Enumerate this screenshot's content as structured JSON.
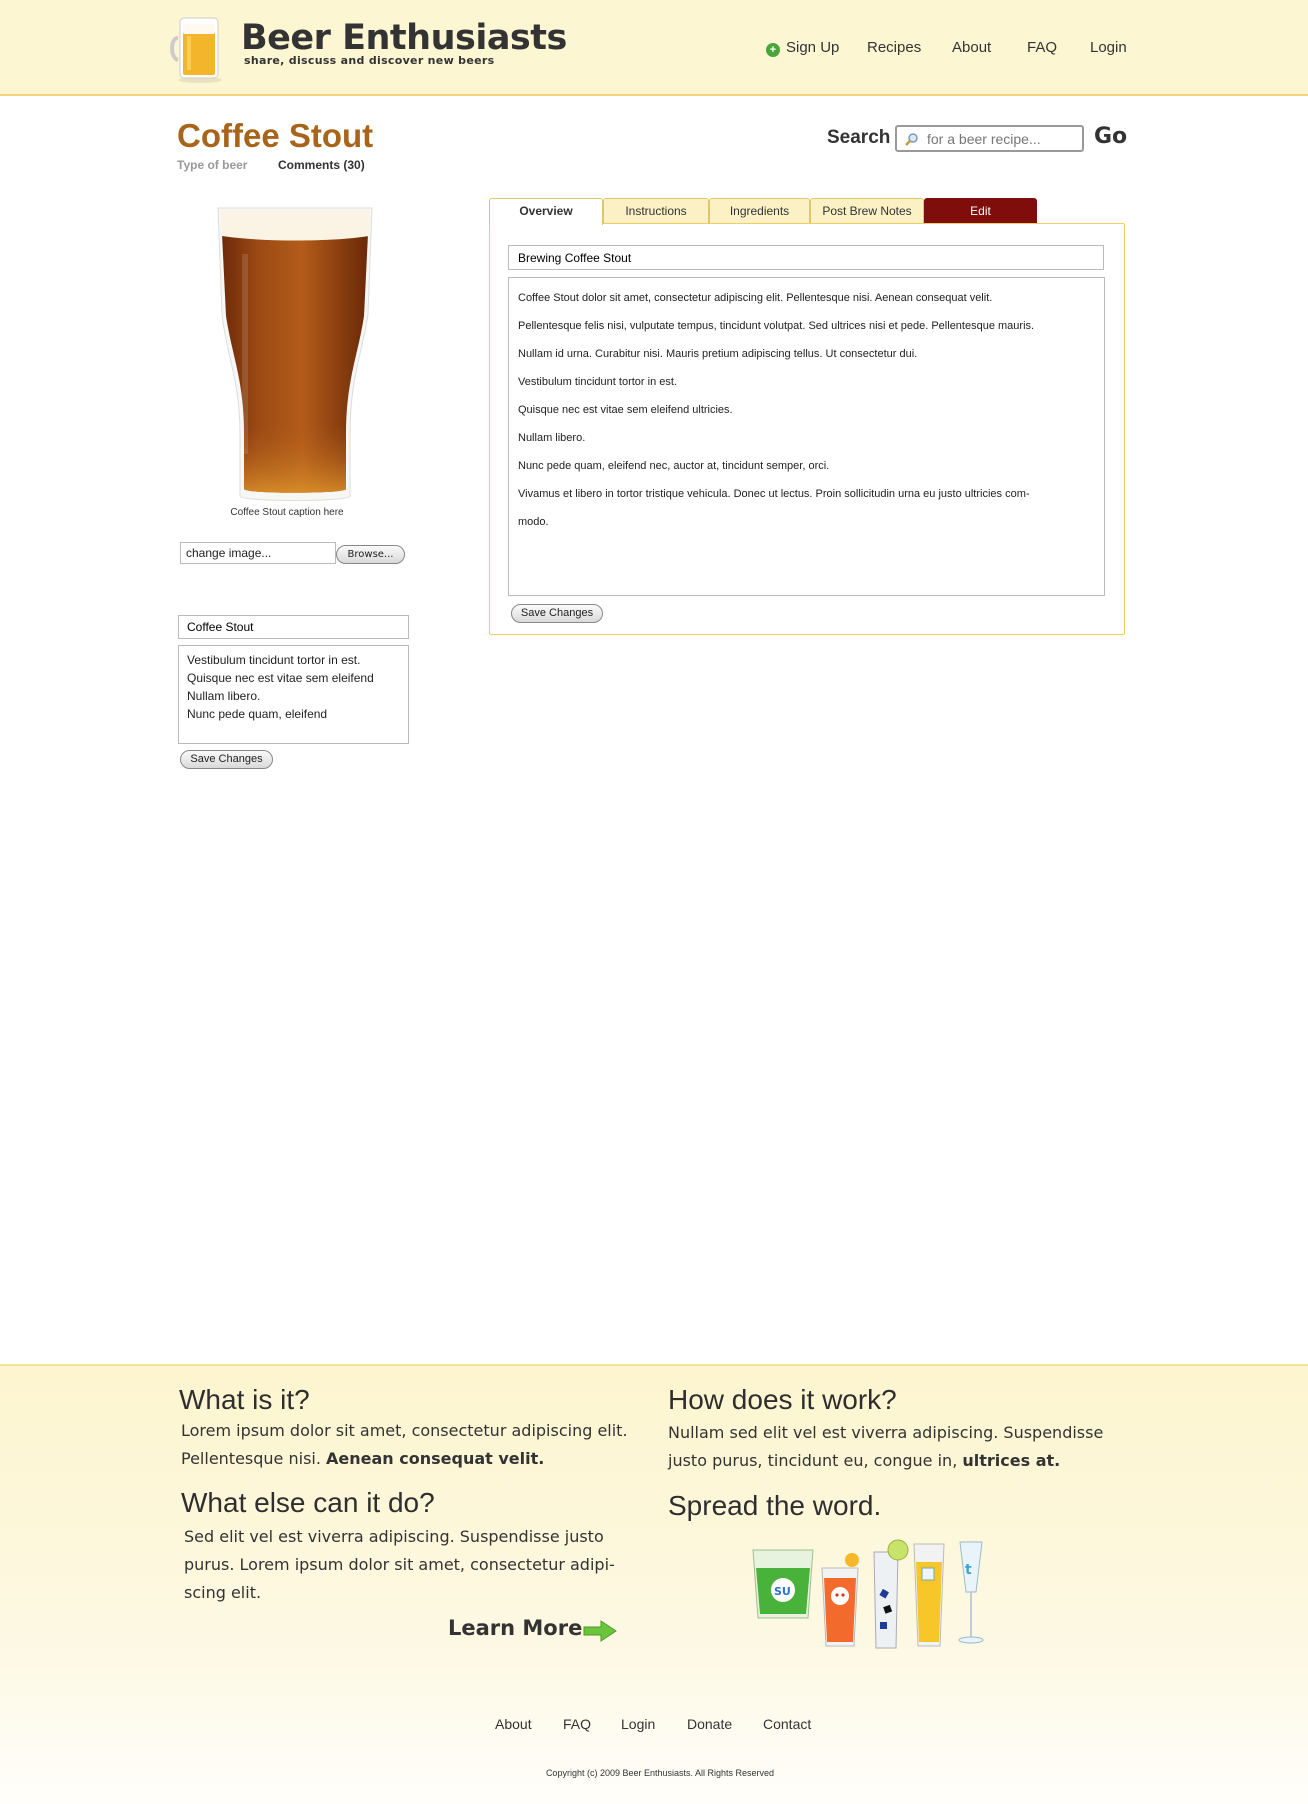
{
  "header": {
    "brand": "Beer Enthusiasts",
    "tagline": "share, discuss and discover new beers",
    "nav": [
      "Sign Up",
      "Recipes",
      "About",
      "FAQ",
      "Login"
    ]
  },
  "beer": {
    "title": "Coffee Stout",
    "type_label": "Type of beer",
    "comments_label": "Comments (30)",
    "caption": "Coffee Stout caption here"
  },
  "search": {
    "label": "Search",
    "placeholder": "for a beer recipe...",
    "go_label": "Go"
  },
  "image_upload": {
    "value": "change image...",
    "browse_label": "Browse..."
  },
  "side_form": {
    "title_value": "Coffee Stout",
    "description_lines": [
      "Vestibulum tincidunt tortor in est.",
      "Quisque nec est vitae sem eleifend",
      "Nullam libero.",
      "Nunc pede quam, eleifend"
    ],
    "save_label": "Save Changes"
  },
  "tabs": [
    "Overview",
    "Instructions",
    "Ingredients",
    "Post Brew Notes",
    "Edit"
  ],
  "panel": {
    "title_value": "Brewing Coffee Stout",
    "text_lines": [
      "Coffee Stout dolor sit amet, consectetur adipiscing elit. Pellentesque nisi. Aenean consequat velit.",
      "Pellentesque felis nisi, vulputate tempus, tincidunt volutpat. Sed ultrices nisi et pede. Pellentesque mauris.",
      "Nullam id urna. Curabitur nisi. Mauris pretium adipiscing tellus. Ut consectetur dui.",
      "Vestibulum tincidunt tortor in est.",
      "Quisque nec est vitae sem eleifend ultricies.",
      "Nullam libero.",
      "Nunc pede quam, eleifend nec, auctor at, tincidunt semper, orci.",
      "Vivamus et libero in tortor tristique vehicula. Donec ut lectus. Proin sollicitudin urna eu justo ultricies com-",
      "modo."
    ],
    "save_label": "Save Changes"
  },
  "footer": {
    "what_title": "What is it?",
    "what_line1": "Lorem ipsum dolor sit amet, consectetur adipiscing elit.",
    "what_line2": "Pellentesque nisi.",
    "what_line2_bold": "Aenean consequat velit.",
    "else_title": "What else can it do?",
    "else_line1": "Sed elit vel est viverra adipiscing. Suspendisse justo",
    "else_line2": "purus. Lorem ipsum dolor sit amet, consectetur adipi-",
    "else_line3": "scing elit.",
    "how_title": "How does it work?",
    "how_line1": "Nullam sed elit vel est viverra adipiscing. Suspendisse",
    "how_line2": "justo purus, tincidunt eu, congue in,",
    "how_line2_bold": "ultrices at.",
    "spread_title": "Spread the word.",
    "learn_more": "Learn More",
    "nav": [
      "About",
      "FAQ",
      "Login",
      "Donate",
      "Contact"
    ],
    "copyright": "Copyright (c) 2009 Beer Enthusiasts. All Rights Reserved"
  },
  "colors": {
    "brand_brown": "#a8641b",
    "edit_tab": "#7e0d0c",
    "header_bg": "#fdf6d2",
    "accent_border": "#efcf62"
  }
}
